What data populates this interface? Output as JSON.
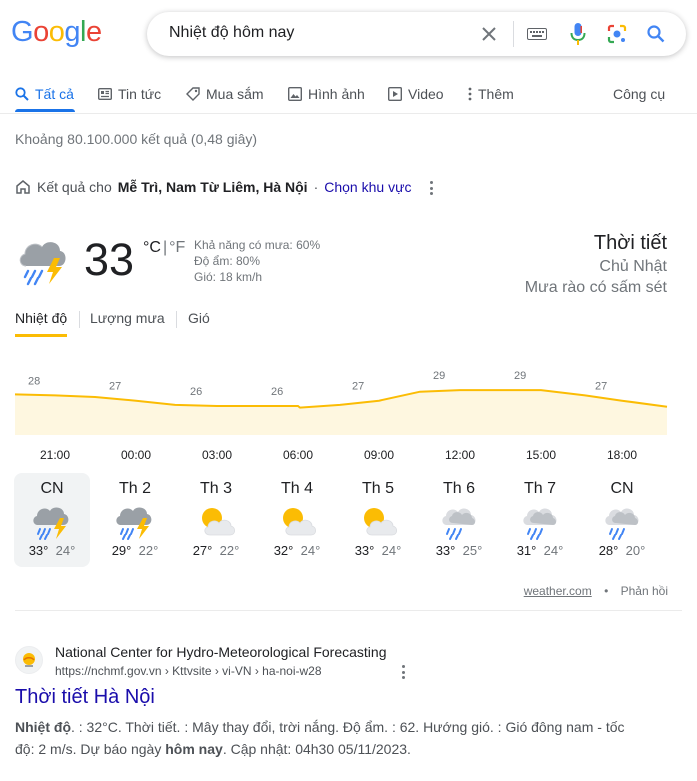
{
  "logo": {
    "letters": [
      "G",
      "o",
      "o",
      "g",
      "l",
      "e"
    ],
    "colors": [
      "#4285F4",
      "#EA4335",
      "#FBBC05",
      "#4285F4",
      "#34A853",
      "#EA4335"
    ]
  },
  "search": {
    "query": "Nhiệt độ hôm nay",
    "icons": [
      "clear-icon",
      "keyboard-icon",
      "mic-icon",
      "lens-icon",
      "search-icon"
    ]
  },
  "tabs": [
    {
      "label": "Tất cả",
      "icon": "search-icon"
    },
    {
      "label": "Tin tức",
      "icon": "news-icon"
    },
    {
      "label": "Mua sắm",
      "icon": "tag-icon"
    },
    {
      "label": "Hình ảnh",
      "icon": "image-icon"
    },
    {
      "label": "Video",
      "icon": "play-icon"
    },
    {
      "label": "Thêm",
      "icon": "more-icon"
    }
  ],
  "tools_label": "Công cụ",
  "result_stats": "Khoảng 80.100.000 kết quả (0,48 giây)",
  "location": {
    "prefix": "Kết quả cho",
    "place": "Mễ Trì, Nam Từ Liêm, Hà Nội",
    "dot": "·",
    "change_label": "Chọn khu vực"
  },
  "weather": {
    "temp": "33",
    "unit_c": "°C",
    "unit_sep": "|",
    "unit_f": "°F",
    "precip": "Khả năng có mưa: 60%",
    "humidity": "Độ ẩm: 80%",
    "wind": "Gió: 18 km/h",
    "title": "Thời tiết",
    "day": "Chủ Nhật",
    "desc": "Mưa rào có sấm sét",
    "tabs": [
      "Nhiệt độ",
      "Lượng mưa",
      "Gió"
    ],
    "accent": "#fbbc04"
  },
  "chart_data": {
    "type": "area",
    "x": [
      "21:00",
      "00:00",
      "03:00",
      "06:00",
      "09:00",
      "12:00",
      "15:00",
      "18:00"
    ],
    "values": [
      28,
      27,
      26,
      26,
      27,
      29,
      29,
      27
    ],
    "labels": [
      "28",
      "27",
      "26",
      "26",
      "27",
      "29",
      "29",
      "27"
    ]
  },
  "days": [
    {
      "name": "CN",
      "hi": "33°",
      "lo": "24°",
      "icon": "thunderstorm-icon",
      "selected": true
    },
    {
      "name": "Th 2",
      "hi": "29°",
      "lo": "22°",
      "icon": "thunderstorm-icon"
    },
    {
      "name": "Th 3",
      "hi": "27°",
      "lo": "22°",
      "icon": "partly-sunny-icon"
    },
    {
      "name": "Th 4",
      "hi": "32°",
      "lo": "24°",
      "icon": "partly-sunny-icon"
    },
    {
      "name": "Th 5",
      "hi": "33°",
      "lo": "24°",
      "icon": "partly-sunny-icon"
    },
    {
      "name": "Th 6",
      "hi": "33°",
      "lo": "25°",
      "icon": "rain-icon"
    },
    {
      "name": "Th 7",
      "hi": "31°",
      "lo": "24°",
      "icon": "rain-icon"
    },
    {
      "name": "CN",
      "hi": "28°",
      "lo": "20°",
      "icon": "rain-icon"
    }
  ],
  "attribution": {
    "source": "weather.com",
    "dot": "•",
    "feedback": "Phản hồi"
  },
  "result": {
    "site_name": "National Center for Hydro-Meteorological Forecasting",
    "url": "https://nchmf.gov.vn › Kttvsite › vi-VN › ha-noi-w28",
    "title": "Thời tiết Hà Nội",
    "snippet_parts": [
      {
        "t": "Nhiệt độ",
        "b": true
      },
      {
        "t": ". : 32°C. Thời tiết. : Mây thay đổi, trời nắng. Độ ẩm. : 62. Hướng gió. : Gió đông nam - tốc độ: 2 m/s. Dự báo ngày ",
        "b": false
      },
      {
        "t": "hôm nay",
        "b": true
      },
      {
        "t": ". Cập nhật: 04h30 05/11/2023.",
        "b": false
      }
    ]
  }
}
